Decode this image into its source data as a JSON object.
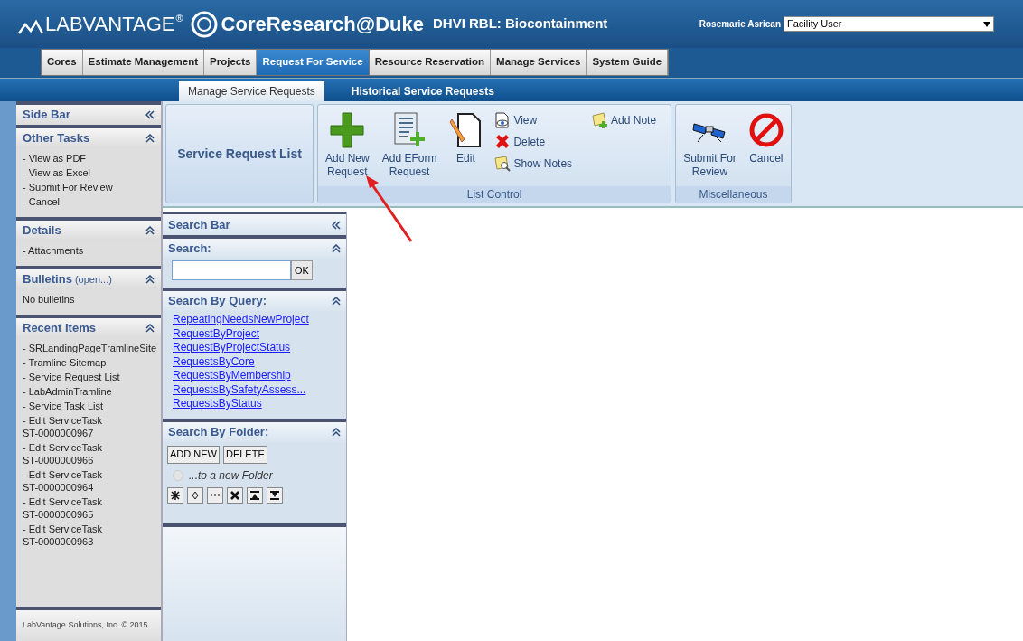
{
  "header": {
    "brand": "LABVANTAGE",
    "brand_mark": "®",
    "product": "CoreResearch@Duke",
    "facility": "DHVI RBL: Biocontainment",
    "user": "Rosemarie Asrican",
    "role": {
      "value": "Facility User"
    }
  },
  "tabs": [
    {
      "label": "Cores",
      "selected": false
    },
    {
      "label": "Estimate Management",
      "selected": false
    },
    {
      "label": "Projects",
      "selected": false
    },
    {
      "label": "Request For Service",
      "selected": true
    },
    {
      "label": "Resource Reservation",
      "selected": false
    },
    {
      "label": "Manage Services",
      "selected": false
    },
    {
      "label": "System Guide",
      "selected": false
    }
  ],
  "subtabs": [
    {
      "label": "Manage Service Requests",
      "selected": true
    },
    {
      "label": "Historical Service Requests",
      "selected": false
    }
  ],
  "sidebar": {
    "title": "Side Bar",
    "panels": [
      {
        "title": "Other Tasks",
        "items": [
          "- View as PDF",
          "- View as Excel",
          "- Submit For Review",
          "- Cancel"
        ]
      },
      {
        "title": "Details",
        "items": [
          "- Attachments"
        ]
      },
      {
        "title": "Bulletins",
        "title_note": "(open...)",
        "items": [
          "No bulletins"
        ]
      },
      {
        "title": "Recent Items",
        "items": [
          "- SRLandingPageTramlineSite",
          "- Tramline Sitemap",
          "- Service Request List",
          "- LabAdminTramline",
          "- Service Task List",
          "- Edit ServiceTask\nST-0000000967",
          "- Edit ServiceTask\nST-0000000966",
          "- Edit ServiceTask\nST-0000000964",
          "- Edit ServiceTask\nST-0000000965",
          "- Edit ServiceTask\nST-0000000963"
        ]
      }
    ],
    "footer": "LabVantage Solutions, Inc. © 2015"
  },
  "ribbon": {
    "page_title": "Service Request List",
    "groups": [
      {
        "label": "List Control",
        "large": [
          {
            "label": "Add New\nRequest",
            "kind": "add"
          },
          {
            "label": "Add EForm\nRequest",
            "kind": "eform"
          },
          {
            "label": "Edit",
            "kind": "edit"
          }
        ],
        "small": [
          [
            {
              "label": "View",
              "kind": "view"
            },
            {
              "label": "Delete",
              "kind": "delete"
            },
            {
              "label": "Show Notes",
              "kind": "notes"
            }
          ],
          [
            {
              "label": "Add Note",
              "kind": "addnote"
            }
          ]
        ]
      },
      {
        "label": "Miscellaneous",
        "large": [
          {
            "label": "Submit For\nReview",
            "kind": "submit"
          },
          {
            "label": "Cancel",
            "kind": "cancel"
          }
        ]
      }
    ]
  },
  "search_bar": {
    "title": "Search Bar",
    "search": {
      "title": "Search:",
      "button": "OK"
    },
    "query": {
      "title": "Search By Query:",
      "links": [
        "RepeatingNeedsNewProject",
        "RequestByProject",
        "RequestByProjectStatus",
        "RequestsByCore",
        "RequestsByMembership",
        "RequestsBySafetyAssess...",
        "RequestsByStatus"
      ]
    },
    "folder": {
      "title": "Search By Folder:",
      "buttons": [
        "ADD NEW",
        "DELETE"
      ],
      "option": {
        "label": "...to a new Folder",
        "selected": false
      },
      "tools": [
        {
          "kind": "asterisk"
        },
        {
          "kind": "diamond"
        },
        {
          "kind": "ellipsis"
        },
        {
          "kind": "cross"
        },
        {
          "kind": "collapse"
        },
        {
          "kind": "expand"
        }
      ]
    }
  }
}
